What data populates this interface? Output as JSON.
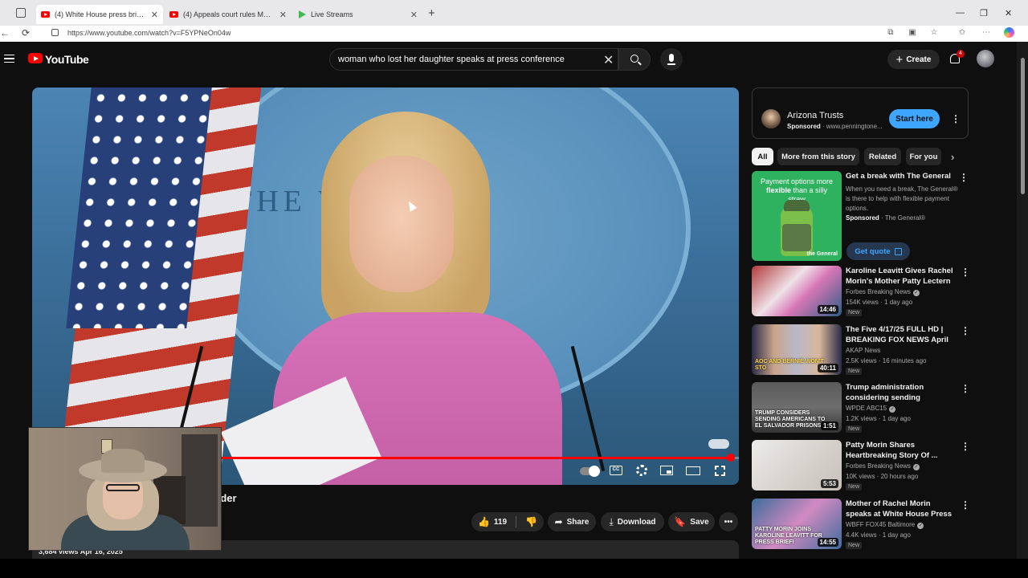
{
  "browser": {
    "tabs": [
      {
        "label": "(4) White House press briefing: Pa",
        "active": true
      },
      {
        "label": "(4) Appeals court rules MD man d",
        "active": false
      },
      {
        "label": "Live Streams",
        "active": false
      }
    ],
    "url": "https://www.youtube.com/watch?v=F5YPNeOn04w",
    "new_tab": "+",
    "controls": {
      "minimize": "—",
      "maximize": "❐",
      "close": "✕"
    },
    "nav": {
      "back": "←",
      "reload": "⟳"
    }
  },
  "masthead": {
    "logo_text": "YouTube",
    "search_value": "woman who lost her daughter speaks at press conference",
    "search_clear": "✕",
    "create_label": "Create",
    "create_plus": "+",
    "notification_count": "4"
  },
  "video": {
    "seal_text": "THE W          USE",
    "progress_fraction": 0.985,
    "title": "h shares story of her daughter's murder",
    "likes": "119",
    "like_icon": "👍",
    "dislike_icon": "👎",
    "share_label": "Share",
    "share_icon": "➦",
    "download_label": "Download",
    "download_icon": "⤓",
    "save_label": "Save",
    "save_icon": "🔖",
    "more_icon": "•••",
    "cc_label": "CC",
    "meta": "3,684 views  Apr 16, 2025"
  },
  "sidebar": {
    "ad": {
      "title": "Arizona Trusts",
      "sponsored": "Sponsored",
      "domain": "www.penningtone...",
      "cta": "Start here"
    },
    "chips": [
      "All",
      "More from this story",
      "Related",
      "For you"
    ],
    "chip_next": "›",
    "promo": {
      "thumb_text_1": "Payment options more ",
      "thumb_text_bold": "flexible",
      "thumb_text_2": " than a silly straw",
      "brand_mark": "the General",
      "title": "Get a break with The General",
      "desc": "When you need a break, The General® is there to help with flexible payment options.",
      "sponsored": "Sponsored",
      "advertiser": "· The General®",
      "cta": "Get quote"
    },
    "videos": [
      {
        "title": "Karoline Leavitt Gives Rachel Morin's Mother Patty Lectern T...",
        "channel": "Forbes Breaking News",
        "verified": true,
        "meta": "154K views · 1 day ago",
        "badge": "New",
        "duration": "14:46",
        "caption": ""
      },
      {
        "title": "The Five 4/17/25 FULL HD | BREAKING FOX NEWS April 17...",
        "channel": "AKAP News",
        "verified": false,
        "meta": "2.5K views · 16 minutes ago",
        "badge": "New",
        "duration": "40:11",
        "caption": "AOC AND BERNIE WON'T STO"
      },
      {
        "title": "Trump administration considering sending American...",
        "channel": "WPDE ABC15",
        "verified": true,
        "meta": "1.2K views · 1 day ago",
        "badge": "New",
        "duration": "1:51",
        "caption": "TRUMP CONSIDERS SENDING AMERICANS TO EL SALVADOR PRISONS"
      },
      {
        "title": "Patty Morin Shares Heartbreaking Story Of ...",
        "channel": "Forbes Breaking News",
        "verified": true,
        "meta": "10K views · 20 hours ago",
        "badge": "New",
        "duration": "5:53",
        "caption": ""
      },
      {
        "title": "Mother of Rachel Morin speaks at White House Press Briefing",
        "channel": "WBFF FOX45 Baltimore",
        "verified": true,
        "meta": "4.4K views · 1 day ago",
        "badge": "New",
        "duration": "14:55",
        "caption": "PATTY MORIN JOINS KAROLINE LEAVITT FOR PRESS BRIEFI"
      }
    ]
  },
  "colors": {
    "background": "#0f0f0f",
    "accent_red": "#ff0000",
    "link_blue": "#3ea6ff",
    "chip_bg": "#272727"
  }
}
